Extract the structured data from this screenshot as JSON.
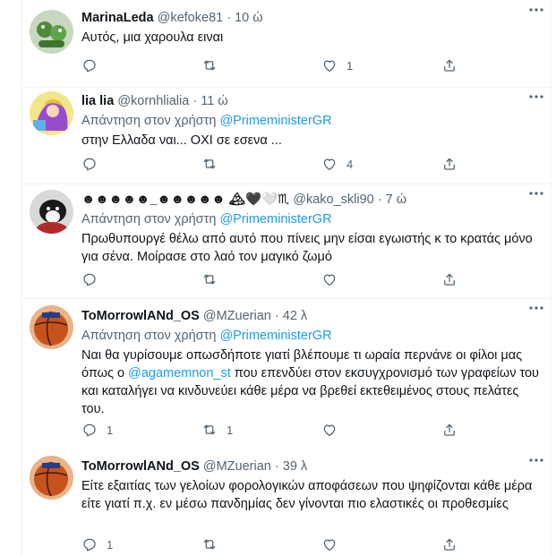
{
  "tweets": [
    {
      "name": "MarinaLeda",
      "handle": "@kefoke81",
      "dot": "·",
      "time": "10 ώ",
      "reply_prefix": "",
      "reply_mention": "",
      "text": "Αυτός, μια χαρουλα ειναι",
      "counts": {
        "reply": "",
        "retweet": "",
        "like": "1"
      },
      "avatar_colors": [
        "#c8d8c0",
        "#4d8a3a"
      ]
    },
    {
      "name": "lia lia",
      "handle": "@kornhlialia",
      "dot": "·",
      "time": "11 ώ",
      "reply_prefix": "Απάντηση στον χρήστη",
      "reply_mention": "@PrimeministerGR",
      "text": "στην Ελλαδα ναι...  ΟΧΙ σε εσενα ...",
      "counts": {
        "reply": "",
        "retweet": "",
        "like": "4"
      },
      "avatar_colors": [
        "#f3e58a",
        "#9a4ccf"
      ]
    },
    {
      "name": "☻☻☻☻☻_☻☻☻☻☻ 🏔🖤🤍♏",
      "handle": "@kako_skli90",
      "dot": "·",
      "time": "7 ώ",
      "reply_prefix": "Απάντηση στον χρήστη",
      "reply_mention": "@PrimeministerGR",
      "text": "Πρωθυπουργέ θέλω από αυτό που πίνεις μην είσαι εγωιστής κ το κρατάς μόνο για σένα. Μοίρασε στο λαό τον μαγικό ζωμό",
      "counts": {
        "reply": "",
        "retweet": "",
        "like": ""
      },
      "avatar_colors": [
        "#d9d9d9",
        "#1a1a1a"
      ]
    },
    {
      "name": "ToMorrowlANd_OS",
      "handle": "@MZuerian",
      "dot": "·",
      "time": "42 λ",
      "reply_prefix": "Απάντηση στον χρήστη",
      "reply_mention": "@PrimeministerGR",
      "text_parts": [
        "Ναι θα γυρίσουμε οπωσδήποτε γιατί βλέπουμε τι ωραία περνάνε οι φίλοι μας όπως ο ",
        "@agamemnon_st",
        " που επενδύει στον εκσυγχρονισμό των γραφείων του και καταλήγει να κινδυνεύει κάθε μέρα να βρεθεί εκτεθειμένος στους πελάτες του."
      ],
      "counts": {
        "reply": "1",
        "retweet": "1",
        "like": ""
      },
      "avatar_colors": [
        "#e8b48a",
        "#c8521c"
      ]
    },
    {
      "name": "ToMorrowlANd_OS",
      "handle": "@MZuerian",
      "dot": "·",
      "time": "39 λ",
      "reply_prefix": "",
      "reply_mention": "",
      "text": "Είτε εξαιτίας των γελοίων φορολογικών  αποφάσεων  που ψηφίζονται κάθε μέρα είτε γιατί π.χ. εν μέσω πανδημίας δεν γίνονται πιο ελαστικές οι προθεσμίες",
      "counts": {
        "reply": "1",
        "retweet": "",
        "like": ""
      },
      "avatar_colors": [
        "#e8b48a",
        "#c8521c"
      ]
    }
  ],
  "icons": {
    "reply": "reply-icon",
    "retweet": "retweet-icon",
    "like": "like-icon",
    "share": "share-icon",
    "more": "more-icon"
  },
  "colors": {
    "text": "#0f1419",
    "secondary": "#536471",
    "accent": "#1d9bf0",
    "border": "#eff3f4"
  }
}
